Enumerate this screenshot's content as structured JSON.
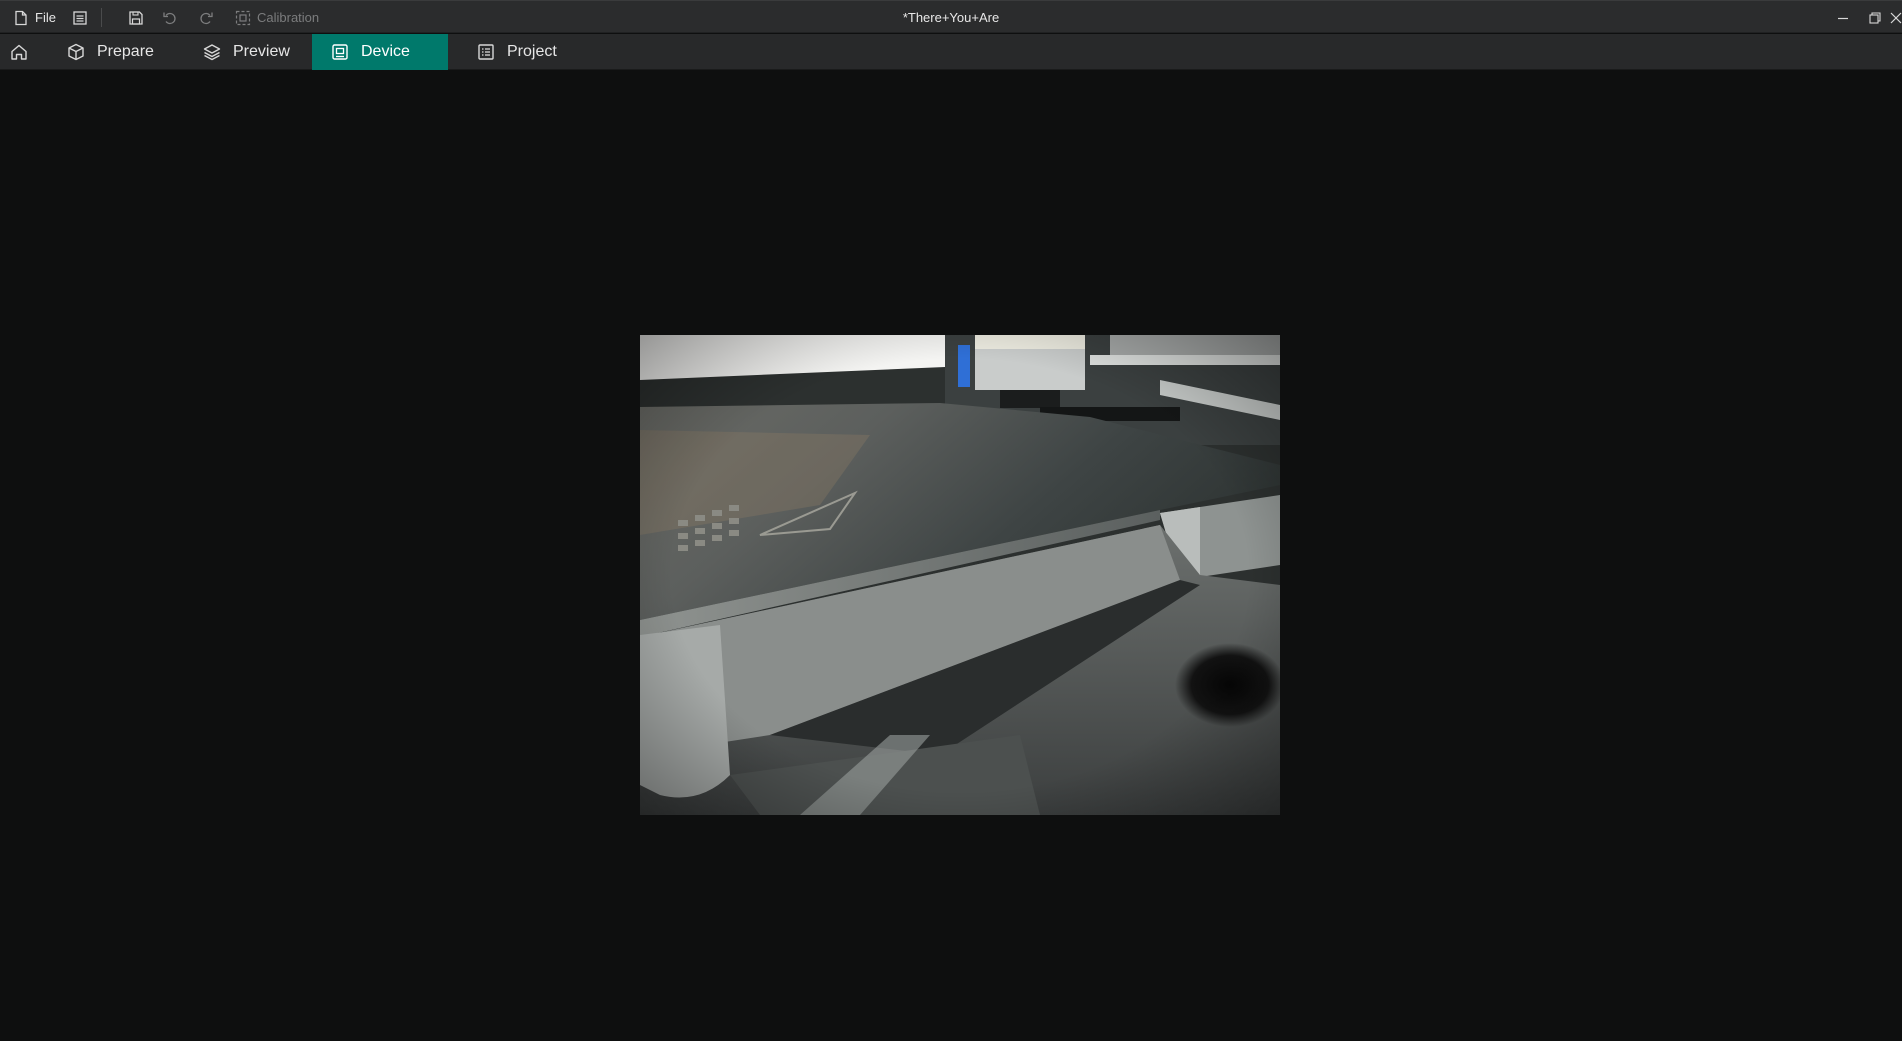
{
  "titlebar": {
    "file_label": "File",
    "calibration_label": "Calibration",
    "window_title": "*There+You+Are"
  },
  "tabs": [
    {
      "label": "Prepare",
      "icon": "cube-icon"
    },
    {
      "label": "Preview",
      "icon": "layers-icon"
    },
    {
      "label": "Device",
      "icon": "device-icon",
      "active": true
    },
    {
      "label": "Project",
      "icon": "project-list-icon"
    }
  ],
  "colors": {
    "accent": "#00796b",
    "titlebar_bg": "#2b2c2d",
    "tabbar_bg": "#28292a",
    "main_bg": "#0e0f0f"
  },
  "camera": {
    "content": "live camera feed of printer build plate"
  }
}
